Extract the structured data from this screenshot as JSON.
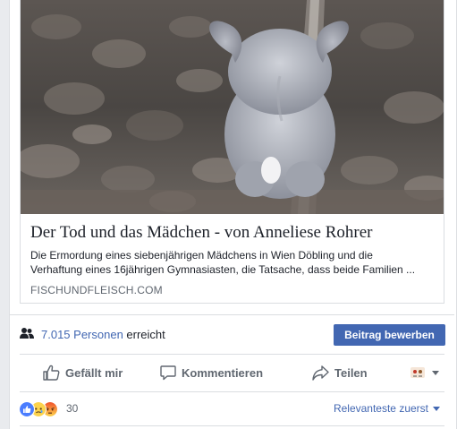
{
  "link_preview": {
    "title": "Der Tod und das Mädchen - von Anneliese Rohrer",
    "description_line1": "Die Ermordung eines siebenjährigen Mädchens in Wien Döbling und die",
    "description_line2": "Verhaftung eines 16jährigen Gymnasiasten, die Tatsache, dass beide Familien ...",
    "domain": "FISCHUNDFLEISCH.COM"
  },
  "reach": {
    "icon": "people-icon",
    "count_label": "7.015 Personen",
    "suffix": "erreicht",
    "boost_label": "Beitrag bewerben"
  },
  "actions": {
    "like_label": "Gefällt mir",
    "comment_label": "Kommentieren",
    "share_label": "Teilen"
  },
  "reactions": {
    "icons": [
      "like-reaction-icon",
      "sad-reaction-icon",
      "angry-reaction-icon"
    ],
    "count": "30",
    "sort_label": "Relevanteste zuerst"
  },
  "colors": {
    "accent": "#4267b2",
    "text": "#1d2129",
    "muted": "#606770",
    "divider": "#dadde1",
    "background": "#e9ebee"
  }
}
